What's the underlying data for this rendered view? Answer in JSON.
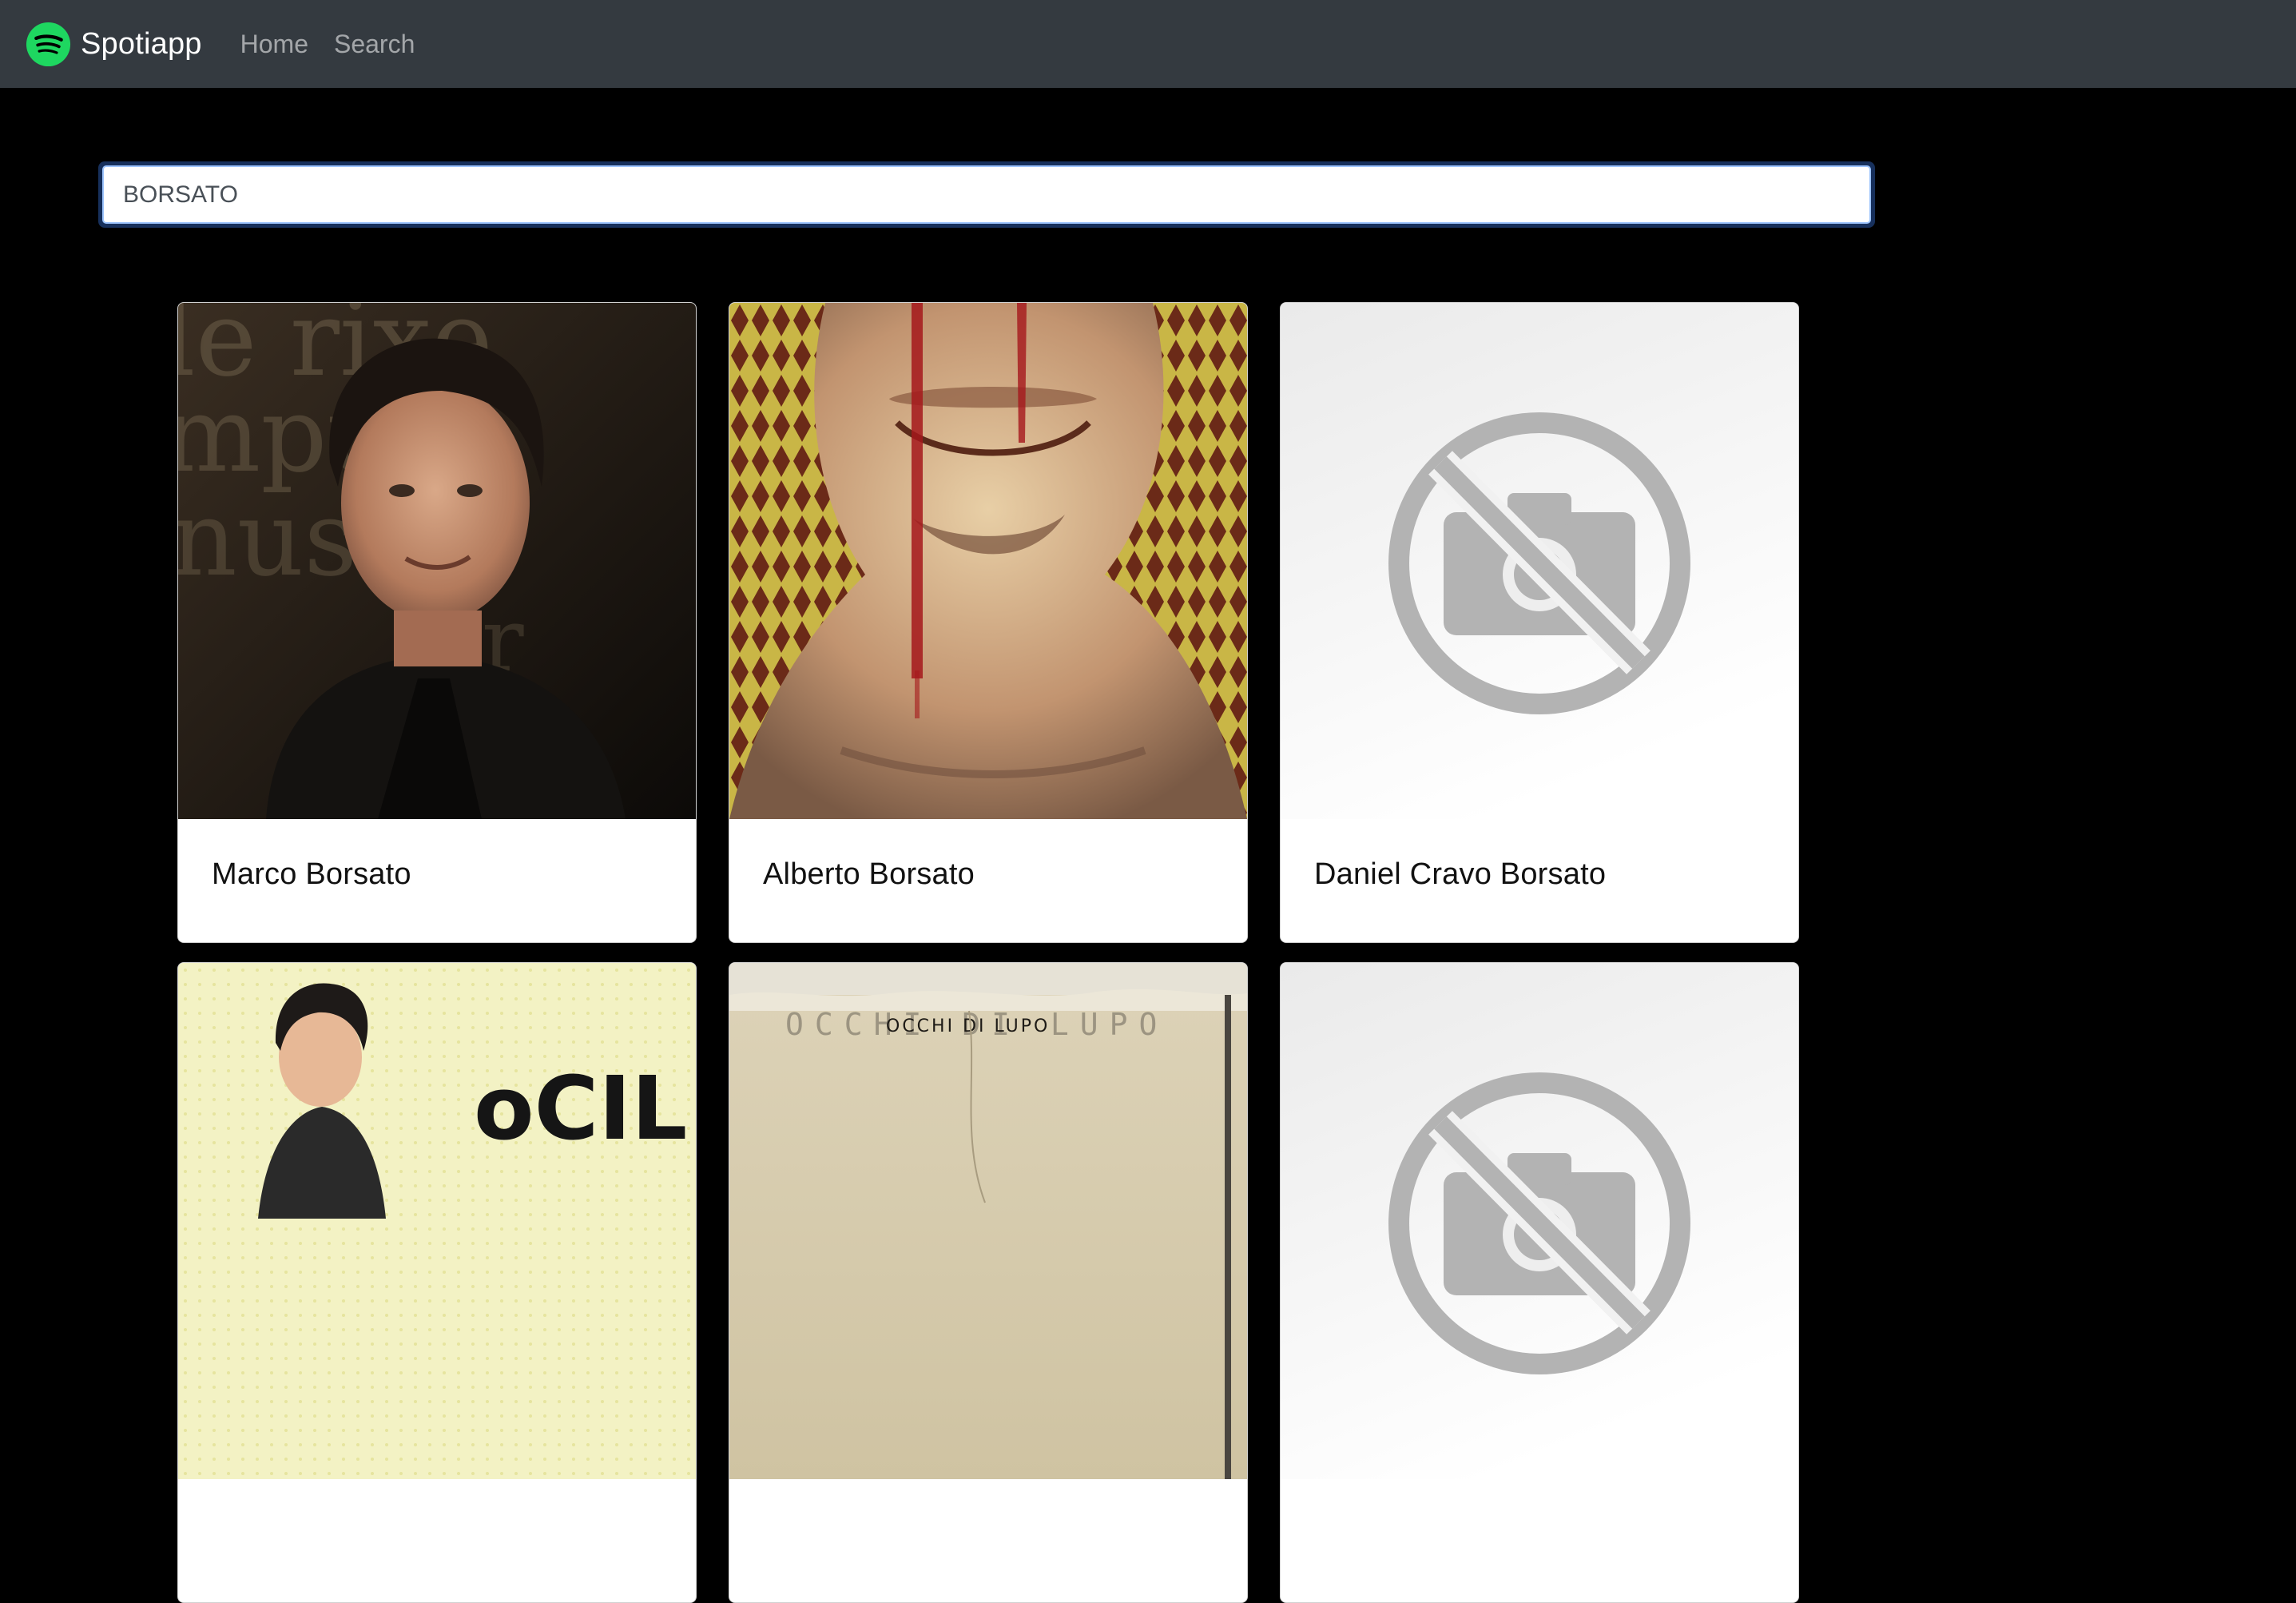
{
  "navbar": {
    "brand": "Spotiapp",
    "brand_color": "#1ed760",
    "background": "#343a40",
    "links": [
      {
        "label": "Home"
      },
      {
        "label": "Search"
      }
    ]
  },
  "search": {
    "value": "BORSATO",
    "placeholder": "Buscar artista..."
  },
  "artists": [
    {
      "name": "Marco Borsato",
      "image": "portrait-photo"
    },
    {
      "name": "Alberto Borsato",
      "image": "face-artwork"
    },
    {
      "name": "Daniel Cravo Borsato",
      "image": "no-image-icon"
    },
    {
      "name": "",
      "image": "portrait-photo"
    },
    {
      "name": "",
      "image": "album-artwork",
      "image_text": "OCCHI DI LUPO"
    },
    {
      "name": "",
      "image": "no-image-icon"
    }
  ]
}
